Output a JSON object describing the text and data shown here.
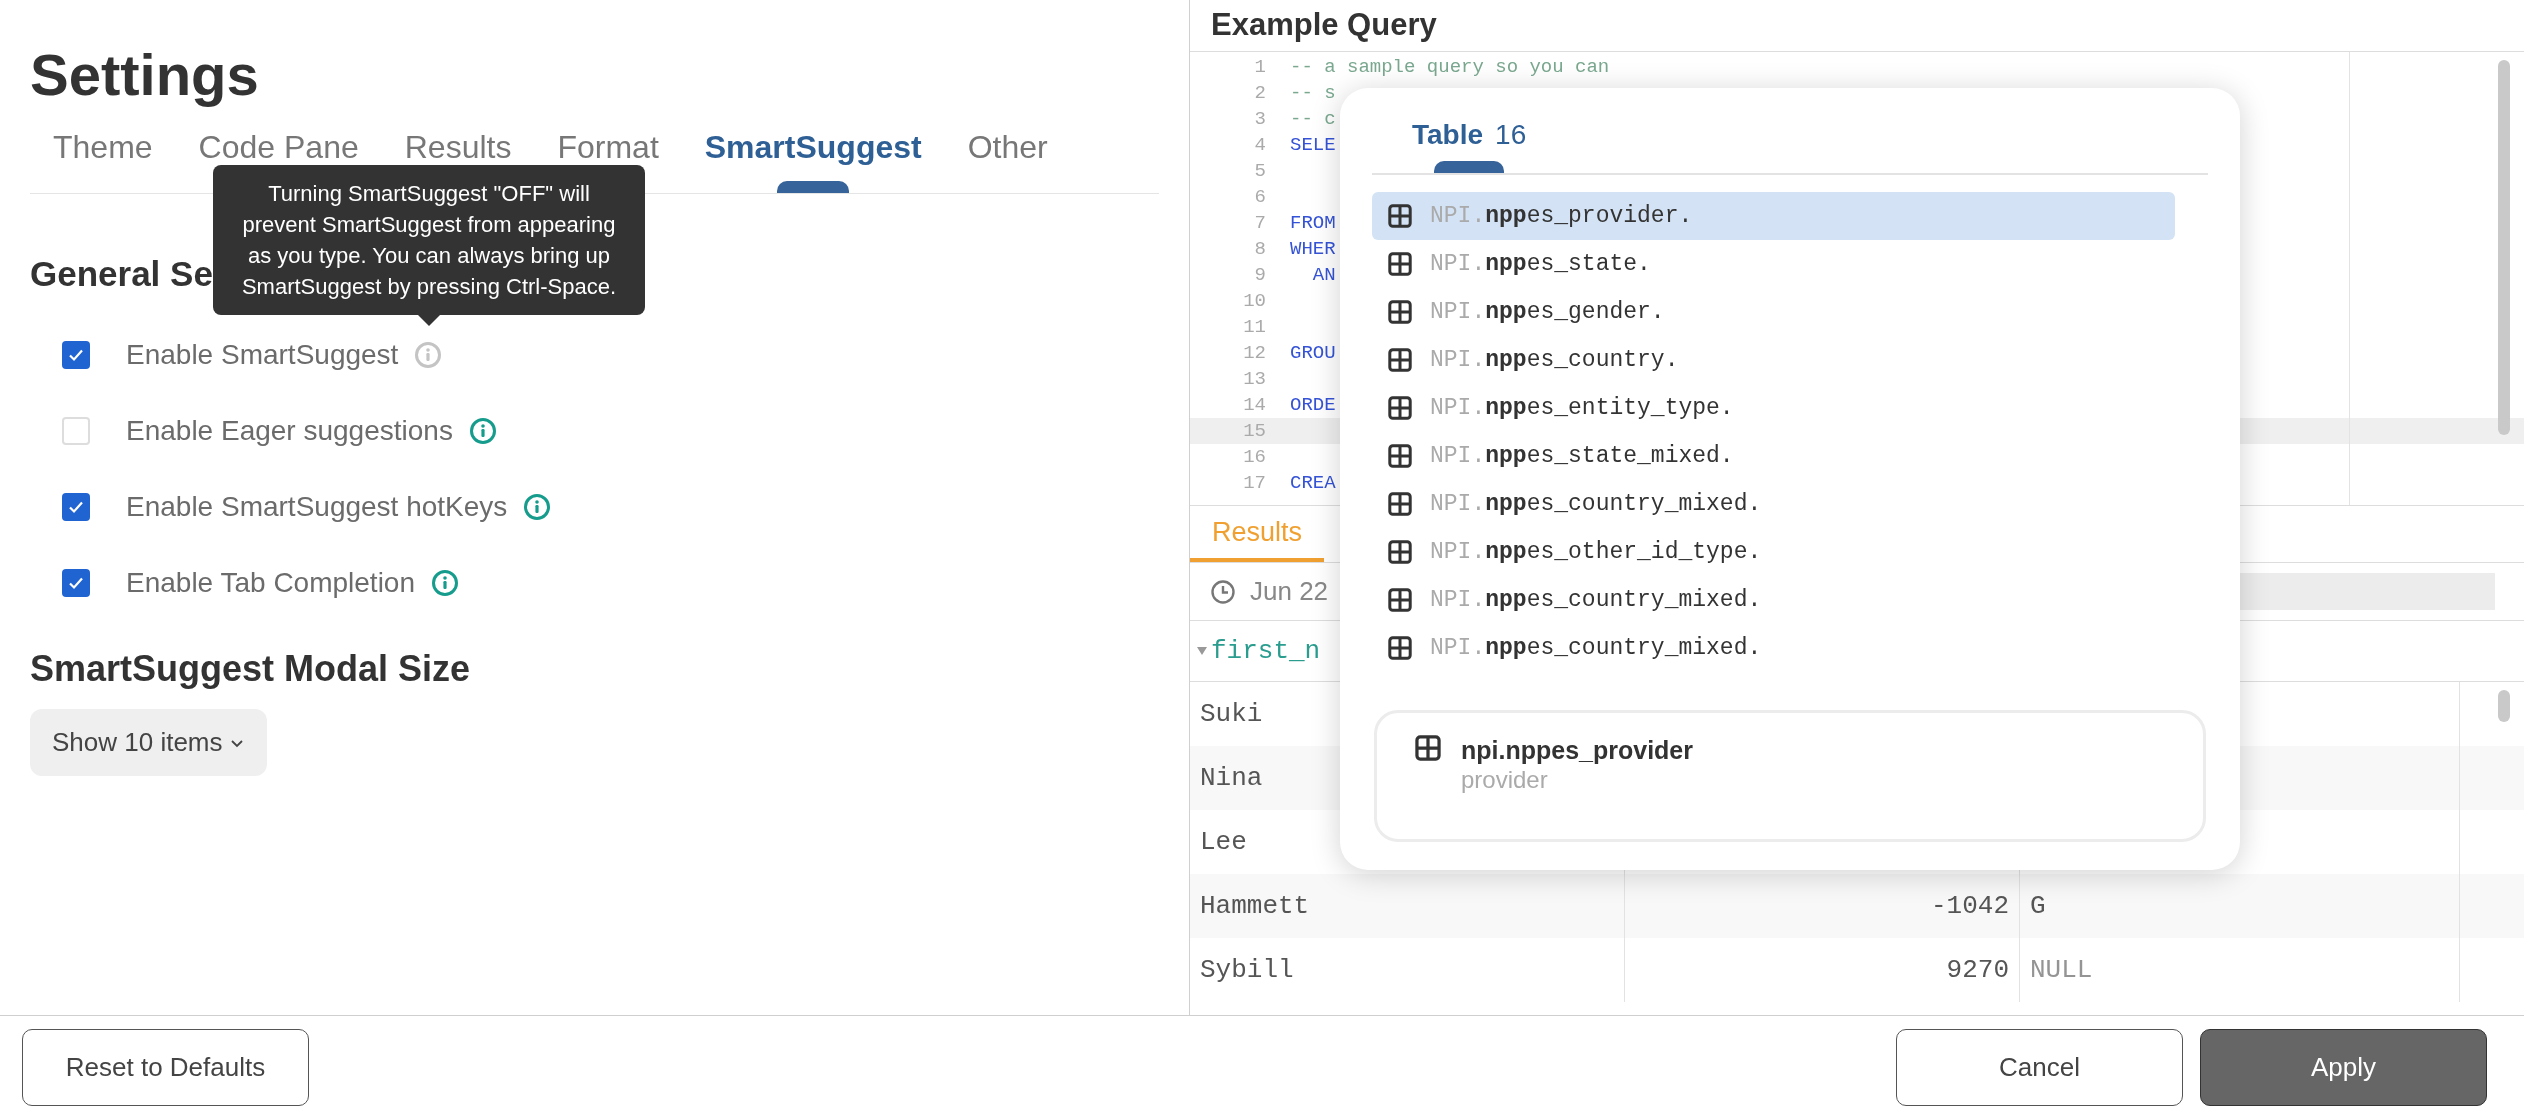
{
  "settings": {
    "title": "Settings",
    "tabs": [
      {
        "label": "Theme",
        "selected": false
      },
      {
        "label": "Code Pane",
        "selected": false
      },
      {
        "label": "Results",
        "selected": false
      },
      {
        "label": "Format",
        "selected": false
      },
      {
        "label": "SmartSuggest",
        "selected": true
      },
      {
        "label": "Other",
        "selected": false
      }
    ],
    "tooltip": "Turning SmartSuggest \"OFF\" will prevent SmartSuggest from appearing as you type. You can always bring up SmartSuggest by pressing Ctrl-Space.",
    "general_heading": "General Se",
    "options": [
      {
        "label": "Enable SmartSuggest",
        "checked": true,
        "hovered": true
      },
      {
        "label": "Enable Eager suggestions",
        "checked": false,
        "hovered": false
      },
      {
        "label": "Enable SmartSuggest hotKeys",
        "checked": true,
        "hovered": false
      },
      {
        "label": "Enable Tab Completion",
        "checked": true,
        "hovered": false
      }
    ],
    "modal_heading": "SmartSuggest Modal Size",
    "modal_dropdown": "Show 10 items"
  },
  "editor": {
    "title": "Example Query",
    "lines": [
      {
        "number": "1",
        "text": "-- a sample query so you can",
        "kind": "comment",
        "current": false
      },
      {
        "number": "2",
        "text": "-- s",
        "kind": "comment",
        "current": false
      },
      {
        "number": "3",
        "text": "-- c",
        "kind": "comment",
        "current": false
      },
      {
        "number": "4",
        "text": "SELE",
        "kind": "keyword",
        "current": false
      },
      {
        "number": "5",
        "kind": "blank",
        "current": false
      },
      {
        "number": "6",
        "kind": "blank",
        "current": false
      },
      {
        "number": "7",
        "text": "FROM",
        "kind": "keyword",
        "current": false
      },
      {
        "number": "8",
        "text": "WHER",
        "kind": "keyword",
        "current": false
      },
      {
        "number": "9",
        "text": "  AN",
        "kind": "keyword",
        "current": false
      },
      {
        "number": "10",
        "kind": "blank",
        "current": false
      },
      {
        "number": "11",
        "kind": "blank",
        "current": false
      },
      {
        "number": "12",
        "text": "GROU",
        "kind": "keyword",
        "current": false
      },
      {
        "number": "13",
        "kind": "blank",
        "current": false
      },
      {
        "number": "14",
        "text": "ORDE",
        "kind": "keyword",
        "current": false
      },
      {
        "number": "15",
        "kind": "blank",
        "current": true
      },
      {
        "number": "16",
        "kind": "blank",
        "current": false
      },
      {
        "number": "17",
        "text": "CREA",
        "kind": "keyword",
        "current": false
      }
    ]
  },
  "suggest": {
    "tab": "Table",
    "count": "16",
    "items": [
      {
        "schema": "NPI.",
        "match": "npp",
        "rest": "es_provider.",
        "selected": true
      },
      {
        "schema": "NPI.",
        "match": "npp",
        "rest": "es_state.",
        "selected": false
      },
      {
        "schema": "NPI.",
        "match": "npp",
        "rest": "es_gender.",
        "selected": false
      },
      {
        "schema": "NPI.",
        "match": "npp",
        "rest": "es_country.",
        "selected": false
      },
      {
        "schema": "NPI.",
        "match": "npp",
        "rest": "es_entity_type.",
        "selected": false
      },
      {
        "schema": "NPI.",
        "match": "npp",
        "rest": "es_state_mixed.",
        "selected": false
      },
      {
        "schema": "NPI.",
        "match": "npp",
        "rest": "es_country_mixed.",
        "selected": false
      },
      {
        "schema": "NPI.",
        "match": "npp",
        "rest": "es_other_id_type.",
        "selected": false
      },
      {
        "schema": "NPI.",
        "match": "npp",
        "rest": "es_country_mixed.",
        "selected": false
      },
      {
        "schema": "NPI.",
        "match": "npp",
        "rest": "es_country_mixed.",
        "selected": false
      }
    ],
    "detail": {
      "name": "npi.nppes_provider",
      "description": "provider"
    }
  },
  "results": {
    "tab": "Results",
    "timestamp": "Jun 22",
    "column_1": "first_n",
    "rows": [
      {
        "cells": [
          {
            "text": "Suki",
            "is_null": false
          }
        ]
      },
      {
        "cells": [
          {
            "text": "Nina",
            "is_null": false
          }
        ]
      },
      {
        "cells": [
          {
            "text": "Lee",
            "is_null": false
          }
        ]
      },
      {
        "cells": [
          {
            "text": "Hammett",
            "is_null": false
          },
          {
            "text": "-1042",
            "is_null": false
          },
          {
            "text": "G",
            "is_null": false
          }
        ]
      },
      {
        "cells": [
          {
            "text": "Sybill",
            "is_null": false
          },
          {
            "text": "9270",
            "is_null": false
          },
          {
            "text": "NULL",
            "is_null": true
          }
        ]
      }
    ]
  },
  "footer": {
    "reset": "Reset to Defaults",
    "cancel": "Cancel",
    "apply": "Apply"
  }
}
